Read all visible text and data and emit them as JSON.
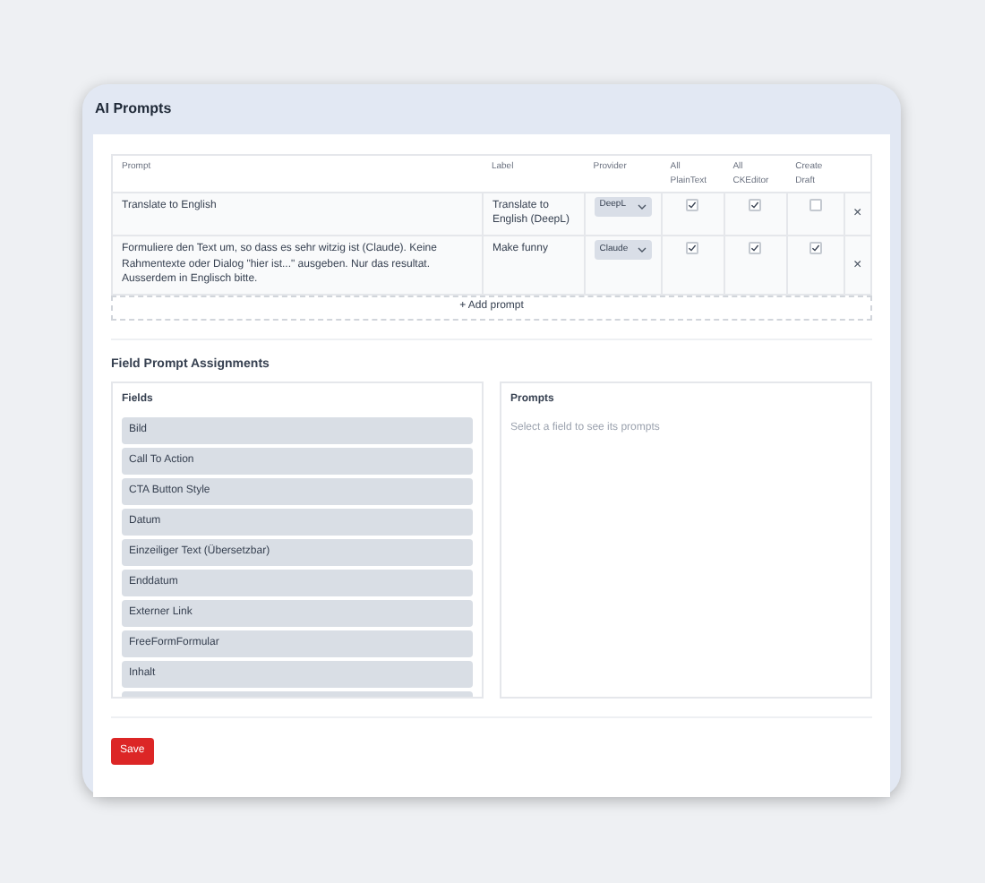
{
  "window": {
    "title": "AI Prompts"
  },
  "table": {
    "columns": [
      "Prompt",
      "Label",
      "Provider",
      "All PlainText",
      "All CKEditor",
      "Create Draft"
    ],
    "rows": [
      {
        "prompt": "Translate to English",
        "label": "Translate to English (DeepL)",
        "provider": "DeepL",
        "all_plaintext": true,
        "all_ckeditor": true,
        "create_draft": false,
        "remove": "×"
      },
      {
        "prompt": "Formuliere den Text um, so dass es sehr witzig ist (Claude). Keine Rahmentexte oder Dialog \"hier ist...\" ausgeben. Nur das resultat. Ausserdem in Englisch bitte.",
        "label": "Make funny",
        "provider": "Claude",
        "all_plaintext": true,
        "all_ckeditor": true,
        "create_draft": true,
        "remove": "×"
      }
    ],
    "add_button": "+ Add prompt"
  },
  "assignments": {
    "title": "Field Prompt Assignments",
    "fields": {
      "title": "Fields",
      "items": [
        "Bild",
        "Call To Action",
        "CTA Button Style",
        "Datum",
        "Einzeiliger Text (Übersetzbar)",
        "Enddatum",
        "Externer Link",
        "FreeFormFormular",
        "Inhalt"
      ]
    },
    "prompts": {
      "title": "Prompts",
      "empty_text": "Select a field to see its prompts"
    }
  },
  "save_button": "Save"
}
